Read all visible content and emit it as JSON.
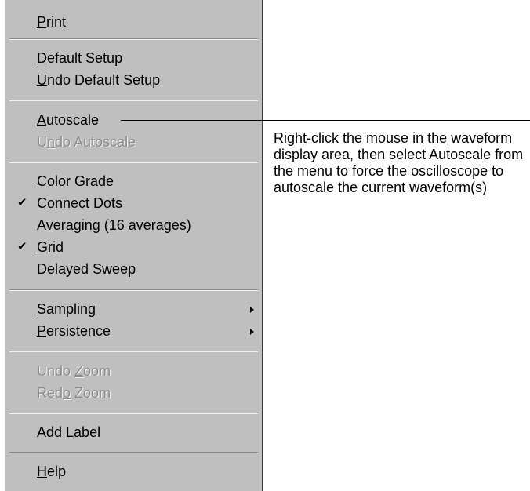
{
  "menu": {
    "items": [
      {
        "label": "Print",
        "mnemonic": "P",
        "enabled": true,
        "checked": false,
        "submenu": false
      },
      {
        "label": "Default Setup",
        "mnemonic": "D",
        "enabled": true,
        "checked": false,
        "submenu": false
      },
      {
        "label": "Undo Default Setup",
        "mnemonic": "U",
        "enabled": true,
        "checked": false,
        "submenu": false
      },
      {
        "label": "Autoscale",
        "mnemonic": "A",
        "enabled": true,
        "checked": false,
        "submenu": false
      },
      {
        "label": "Undo Autoscale",
        "mnemonic": "n",
        "enabled": false,
        "checked": false,
        "submenu": false
      },
      {
        "label": "Color Grade",
        "mnemonic": "C",
        "enabled": true,
        "checked": false,
        "submenu": false
      },
      {
        "label": "Connect Dots",
        "mnemonic": "o",
        "enabled": true,
        "checked": true,
        "submenu": false
      },
      {
        "label": "Averaging (16  averages)",
        "mnemonic": "v",
        "enabled": true,
        "checked": false,
        "submenu": false
      },
      {
        "label": "Grid",
        "mnemonic": "G",
        "enabled": true,
        "checked": true,
        "submenu": false
      },
      {
        "label": "Delayed Sweep",
        "mnemonic": "e",
        "enabled": true,
        "checked": false,
        "submenu": false
      },
      {
        "label": "Sampling",
        "mnemonic": "S",
        "enabled": true,
        "checked": false,
        "submenu": true
      },
      {
        "label": "Persistence",
        "mnemonic": "P",
        "enabled": true,
        "checked": false,
        "submenu": true
      },
      {
        "label": "Undo Zoom",
        "mnemonic": "Z",
        "enabled": false,
        "checked": false,
        "submenu": false
      },
      {
        "label": "Redo Zoom",
        "mnemonic": "o",
        "enabled": false,
        "checked": false,
        "submenu": false
      },
      {
        "label": "Add Label",
        "mnemonic": "L",
        "enabled": true,
        "checked": false,
        "submenu": false
      },
      {
        "label": "Help",
        "mnemonic": "H",
        "enabled": true,
        "checked": false,
        "submenu": false
      }
    ],
    "check_glyph": "✔"
  },
  "callout": {
    "text": "Right-click the mouse in the waveform display area, then select Autoscale from the menu to force the oscilloscope to autoscale the current waveform(s)"
  },
  "colors": {
    "menu_background": "#bfbfbf",
    "disabled_text": "#8d8d8d"
  }
}
